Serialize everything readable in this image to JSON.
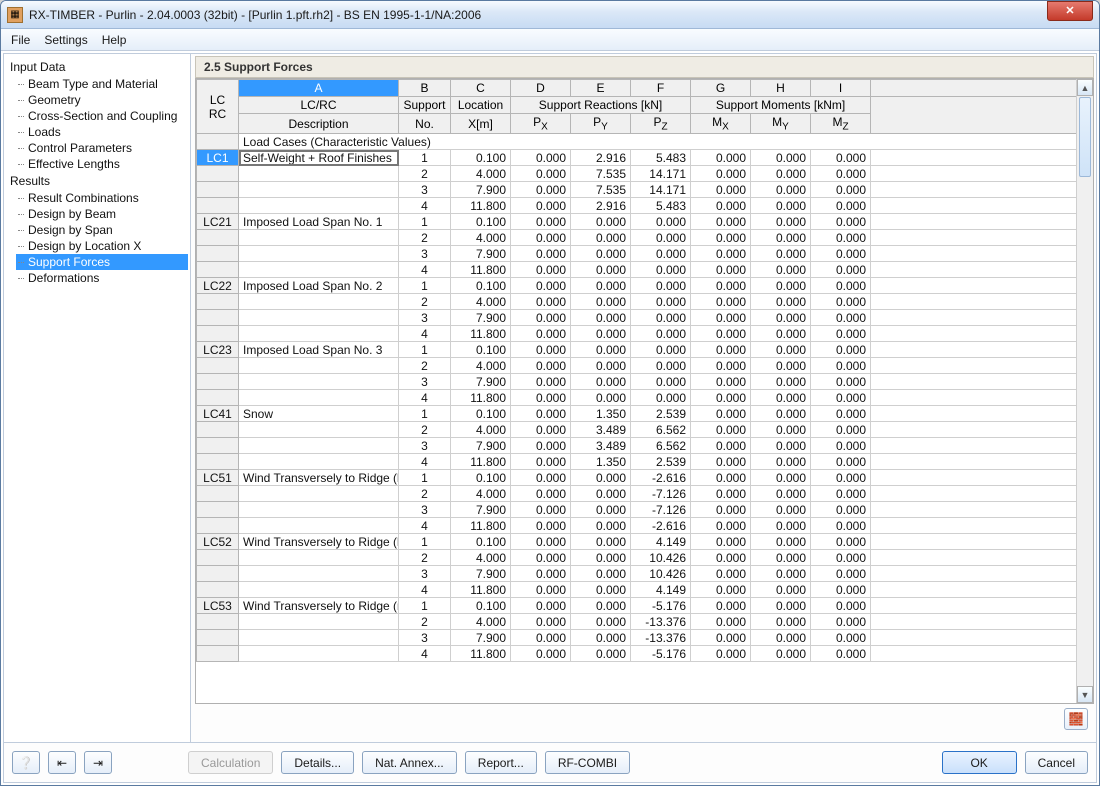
{
  "window": {
    "title": "RX-TIMBER - Purlin - 2.04.0003 (32bit) - [Purlin 1.pft.rh2] - BS EN 1995-1-1/NA:2006"
  },
  "menu": {
    "file": "File",
    "settings": "Settings",
    "help": "Help"
  },
  "sidebar": {
    "input_data": "Input Data",
    "input_items": [
      "Beam Type and Material",
      "Geometry",
      "Cross-Section and Coupling",
      "Loads",
      "Control Parameters",
      "Effective Lengths"
    ],
    "results": "Results",
    "result_items": [
      "Result Combinations",
      "Design by Beam",
      "Design by Span",
      "Design by Location X",
      "Support Forces",
      "Deformations"
    ],
    "selected": "Support Forces"
  },
  "content": {
    "title": "2.5 Support Forces"
  },
  "table": {
    "col_letters": [
      "A",
      "B",
      "C",
      "D",
      "E",
      "F",
      "G",
      "H",
      "I"
    ],
    "header": {
      "lc_rc_top": "LC/RC",
      "lc_rc_bottom": "Description",
      "lc_col_top": "LC",
      "lc_col_bottom": "RC",
      "support": "Support",
      "no": "No.",
      "location": "Location",
      "xm": "X[m]",
      "reactions": "Support Reactions [kN]",
      "moments": "Support Moments [kNm]",
      "px": "P",
      "py": "P",
      "pz": "P",
      "mx": "M",
      "my": "M",
      "mz": "M"
    },
    "section_label": "Load Cases (Characteristic Values)",
    "groups": [
      {
        "lc": "LC1",
        "desc": "Self-Weight + Roof Finishes",
        "rows": [
          {
            "s": 1,
            "x": "0.100",
            "px": "0.000",
            "py": "2.916",
            "pz": "5.483",
            "mx": "0.000",
            "my": "0.000",
            "mz": "0.000"
          },
          {
            "s": 2,
            "x": "4.000",
            "px": "0.000",
            "py": "7.535",
            "pz": "14.171",
            "mx": "0.000",
            "my": "0.000",
            "mz": "0.000"
          },
          {
            "s": 3,
            "x": "7.900",
            "px": "0.000",
            "py": "7.535",
            "pz": "14.171",
            "mx": "0.000",
            "my": "0.000",
            "mz": "0.000"
          },
          {
            "s": 4,
            "x": "11.800",
            "px": "0.000",
            "py": "2.916",
            "pz": "5.483",
            "mx": "0.000",
            "my": "0.000",
            "mz": "0.000"
          }
        ]
      },
      {
        "lc": "LC21",
        "desc": "Imposed Load Span No. 1",
        "rows": [
          {
            "s": 1,
            "x": "0.100",
            "px": "0.000",
            "py": "0.000",
            "pz": "0.000",
            "mx": "0.000",
            "my": "0.000",
            "mz": "0.000"
          },
          {
            "s": 2,
            "x": "4.000",
            "px": "0.000",
            "py": "0.000",
            "pz": "0.000",
            "mx": "0.000",
            "my": "0.000",
            "mz": "0.000"
          },
          {
            "s": 3,
            "x": "7.900",
            "px": "0.000",
            "py": "0.000",
            "pz": "0.000",
            "mx": "0.000",
            "my": "0.000",
            "mz": "0.000"
          },
          {
            "s": 4,
            "x": "11.800",
            "px": "0.000",
            "py": "0.000",
            "pz": "0.000",
            "mx": "0.000",
            "my": "0.000",
            "mz": "0.000"
          }
        ]
      },
      {
        "lc": "LC22",
        "desc": "Imposed Load Span No. 2",
        "rows": [
          {
            "s": 1,
            "x": "0.100",
            "px": "0.000",
            "py": "0.000",
            "pz": "0.000",
            "mx": "0.000",
            "my": "0.000",
            "mz": "0.000"
          },
          {
            "s": 2,
            "x": "4.000",
            "px": "0.000",
            "py": "0.000",
            "pz": "0.000",
            "mx": "0.000",
            "my": "0.000",
            "mz": "0.000"
          },
          {
            "s": 3,
            "x": "7.900",
            "px": "0.000",
            "py": "0.000",
            "pz": "0.000",
            "mx": "0.000",
            "my": "0.000",
            "mz": "0.000"
          },
          {
            "s": 4,
            "x": "11.800",
            "px": "0.000",
            "py": "0.000",
            "pz": "0.000",
            "mx": "0.000",
            "my": "0.000",
            "mz": "0.000"
          }
        ]
      },
      {
        "lc": "LC23",
        "desc": "Imposed Load Span No. 3",
        "rows": [
          {
            "s": 1,
            "x": "0.100",
            "px": "0.000",
            "py": "0.000",
            "pz": "0.000",
            "mx": "0.000",
            "my": "0.000",
            "mz": "0.000"
          },
          {
            "s": 2,
            "x": "4.000",
            "px": "0.000",
            "py": "0.000",
            "pz": "0.000",
            "mx": "0.000",
            "my": "0.000",
            "mz": "0.000"
          },
          {
            "s": 3,
            "x": "7.900",
            "px": "0.000",
            "py": "0.000",
            "pz": "0.000",
            "mx": "0.000",
            "my": "0.000",
            "mz": "0.000"
          },
          {
            "s": 4,
            "x": "11.800",
            "px": "0.000",
            "py": "0.000",
            "pz": "0.000",
            "mx": "0.000",
            "my": "0.000",
            "mz": "0.000"
          }
        ]
      },
      {
        "lc": "LC41",
        "desc": "Snow",
        "rows": [
          {
            "s": 1,
            "x": "0.100",
            "px": "0.000",
            "py": "1.350",
            "pz": "2.539",
            "mx": "0.000",
            "my": "0.000",
            "mz": "0.000"
          },
          {
            "s": 2,
            "x": "4.000",
            "px": "0.000",
            "py": "3.489",
            "pz": "6.562",
            "mx": "0.000",
            "my": "0.000",
            "mz": "0.000"
          },
          {
            "s": 3,
            "x": "7.900",
            "px": "0.000",
            "py": "3.489",
            "pz": "6.562",
            "mx": "0.000",
            "my": "0.000",
            "mz": "0.000"
          },
          {
            "s": 4,
            "x": "11.800",
            "px": "0.000",
            "py": "1.350",
            "pz": "2.539",
            "mx": "0.000",
            "my": "0.000",
            "mz": "0.000"
          }
        ]
      },
      {
        "lc": "LC51",
        "desc": "Wind Transversely to Ridge (left",
        "rows": [
          {
            "s": 1,
            "x": "0.100",
            "px": "0.000",
            "py": "0.000",
            "pz": "-2.616",
            "mx": "0.000",
            "my": "0.000",
            "mz": "0.000"
          },
          {
            "s": 2,
            "x": "4.000",
            "px": "0.000",
            "py": "0.000",
            "pz": "-7.126",
            "mx": "0.000",
            "my": "0.000",
            "mz": "0.000"
          },
          {
            "s": 3,
            "x": "7.900",
            "px": "0.000",
            "py": "0.000",
            "pz": "-7.126",
            "mx": "0.000",
            "my": "0.000",
            "mz": "0.000"
          },
          {
            "s": 4,
            "x": "11.800",
            "px": "0.000",
            "py": "0.000",
            "pz": "-2.616",
            "mx": "0.000",
            "my": "0.000",
            "mz": "0.000"
          }
        ]
      },
      {
        "lc": "LC52",
        "desc": "Wind Transversely to Ridge (left",
        "rows": [
          {
            "s": 1,
            "x": "0.100",
            "px": "0.000",
            "py": "0.000",
            "pz": "4.149",
            "mx": "0.000",
            "my": "0.000",
            "mz": "0.000"
          },
          {
            "s": 2,
            "x": "4.000",
            "px": "0.000",
            "py": "0.000",
            "pz": "10.426",
            "mx": "0.000",
            "my": "0.000",
            "mz": "0.000"
          },
          {
            "s": 3,
            "x": "7.900",
            "px": "0.000",
            "py": "0.000",
            "pz": "10.426",
            "mx": "0.000",
            "my": "0.000",
            "mz": "0.000"
          },
          {
            "s": 4,
            "x": "11.800",
            "px": "0.000",
            "py": "0.000",
            "pz": "4.149",
            "mx": "0.000",
            "my": "0.000",
            "mz": "0.000"
          }
        ]
      },
      {
        "lc": "LC53",
        "desc": "Wind Transversely to Ridge (rig",
        "rows": [
          {
            "s": 1,
            "x": "0.100",
            "px": "0.000",
            "py": "0.000",
            "pz": "-5.176",
            "mx": "0.000",
            "my": "0.000",
            "mz": "0.000"
          },
          {
            "s": 2,
            "x": "4.000",
            "px": "0.000",
            "py": "0.000",
            "pz": "-13.376",
            "mx": "0.000",
            "my": "0.000",
            "mz": "0.000"
          },
          {
            "s": 3,
            "x": "7.900",
            "px": "0.000",
            "py": "0.000",
            "pz": "-13.376",
            "mx": "0.000",
            "my": "0.000",
            "mz": "0.000"
          },
          {
            "s": 4,
            "x": "11.800",
            "px": "0.000",
            "py": "0.000",
            "pz": "-5.176",
            "mx": "0.000",
            "my": "0.000",
            "mz": "0.000"
          }
        ]
      }
    ]
  },
  "buttons": {
    "calculation": "Calculation",
    "details": "Details...",
    "nat_annex": "Nat. Annex...",
    "report": "Report...",
    "rf_combi": "RF-COMBI",
    "ok": "OK",
    "cancel": "Cancel"
  }
}
